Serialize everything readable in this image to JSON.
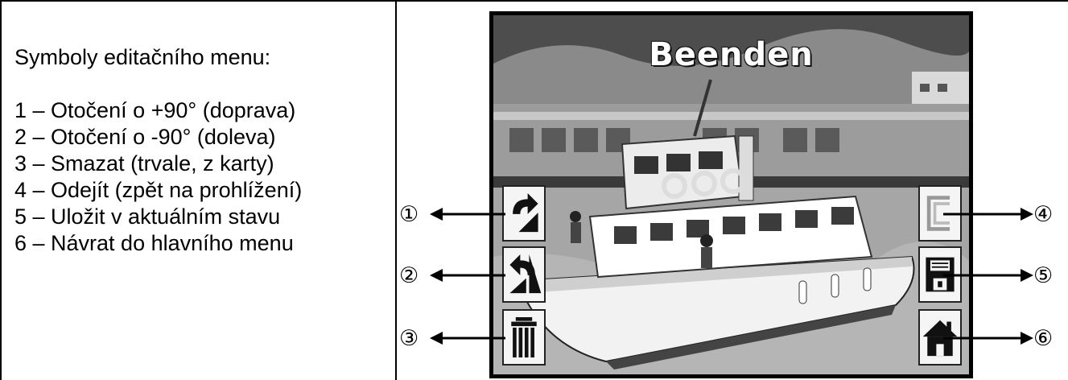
{
  "legend": {
    "heading": "Symboly editačního menu:",
    "items": [
      "1 – Otočení o +90° (doprava)",
      "2 – Otočení o -90° (doleva)",
      "3 – Smazat (trvale, z karty)",
      "4 – Odejít (zpět na prohlížení)",
      "5 – Uložit v aktuálním stavu",
      "6 – Návrat do hlavního menu"
    ]
  },
  "screen": {
    "title": "Beenden"
  },
  "callouts": {
    "one": "①",
    "two": "②",
    "three": "③",
    "four": "④",
    "five": "⑤",
    "six": "⑥"
  }
}
